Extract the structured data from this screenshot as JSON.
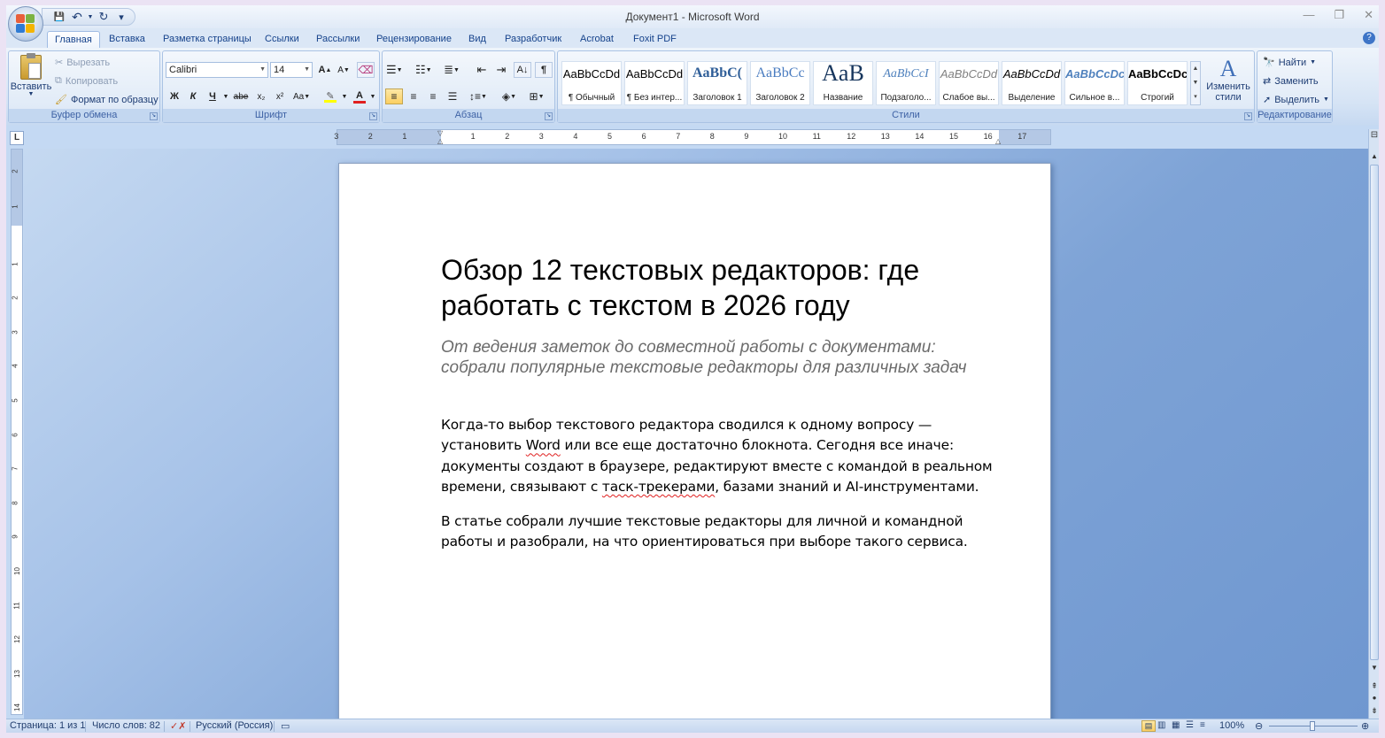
{
  "window": {
    "title": "Документ1 - Microsoft Word",
    "minimize": "—",
    "restore": "❐",
    "close": "✕"
  },
  "qat": {
    "save": "💾",
    "undo": "↶",
    "redo": "↻",
    "customize": "▾"
  },
  "tabs": [
    "Главная",
    "Вставка",
    "Разметка страницы",
    "Ссылки",
    "Рассылки",
    "Рецензирование",
    "Вид",
    "Разработчик",
    "Acrobat",
    "Foxit PDF"
  ],
  "help": "?",
  "clipboard": {
    "paste": "Вставить",
    "cut": "Вырезать",
    "copy": "Копировать",
    "format_painter": "Формат по образцу",
    "label": "Буфер обмена"
  },
  "font": {
    "name": "Calibri",
    "size": "14",
    "grow": "A",
    "shrink": "A",
    "bold": "Ж",
    "italic": "К",
    "underline": "Ч",
    "strike": "abe",
    "subscript": "x₂",
    "superscript": "x²",
    "change_case": "Aa",
    "color_glyph": "A",
    "label": "Шрифт"
  },
  "paragraph": {
    "show_marks": "¶",
    "label": "Абзац"
  },
  "styles": {
    "items": [
      {
        "sample": "AaBbCcDd",
        "name": "¶ Обычный"
      },
      {
        "sample": "AaBbCcDd",
        "name": "¶ Без интер..."
      },
      {
        "sample": "AaBbC(",
        "name": "Заголовок 1"
      },
      {
        "sample": "AaBbCc",
        "name": "Заголовок 2"
      },
      {
        "sample": "AaB",
        "name": "Название"
      },
      {
        "sample": "AaBbCcI",
        "name": "Подзаголо..."
      },
      {
        "sample": "AaBbCcDd",
        "name": "Слабое вы..."
      },
      {
        "sample": "AaBbCcDd",
        "name": "Выделение"
      },
      {
        "sample": "AaBbCcDc",
        "name": "Сильное в..."
      },
      {
        "sample": "AaBbCcDc",
        "name": "Строгий"
      }
    ],
    "change_styles": "Изменить стили",
    "label": "Стили"
  },
  "editing": {
    "find": "Найти",
    "replace": "Заменить",
    "select": "Выделить",
    "label": "Редактирование"
  },
  "ruler": {
    "toggle": "L",
    "marks": [
      "3",
      "2",
      "1",
      "1",
      "2",
      "3",
      "4",
      "5",
      "6",
      "7",
      "8",
      "9",
      "10",
      "11",
      "12",
      "13",
      "14",
      "15",
      "16",
      "17"
    ],
    "vmarks": [
      "2",
      "1",
      "1",
      "2",
      "3",
      "4",
      "5",
      "6",
      "7",
      "8",
      "9",
      "10",
      "11",
      "12",
      "13",
      "14"
    ]
  },
  "document": {
    "title": "Обзор 12 текстовых редакторов: где работать с текстом в 2026 году",
    "subtitle": "От ведения заметок до совместной работы с документами: собрали популярные текстовые редакторы для различных задач",
    "p1_a": "Когда-то выбор текстового редактора сводился к одному вопросу — установить ",
    "p1_word": "Word",
    "p1_b": " или все еще достаточно блокнота. Сегодня все иначе: документы создают в браузере, редактируют вместе с командой в реальном времени, связывают с ",
    "p1_task": "таск-трекерами",
    "p1_c": ", базами знаний и AI-инструментами.",
    "p2": "В статье собрали лучшие текстовые редакторы для личной и командной работы и разобрали, на что ориентироваться  при выборе такого сервиса."
  },
  "status": {
    "page": "Страница: 1 из 1",
    "words": "Число слов: 82",
    "language": "Русский (Россия)",
    "zoom": "100%"
  },
  "colors": {
    "accent": "#15428b",
    "font_color": "#e02020",
    "highlight": "#ffff00"
  }
}
